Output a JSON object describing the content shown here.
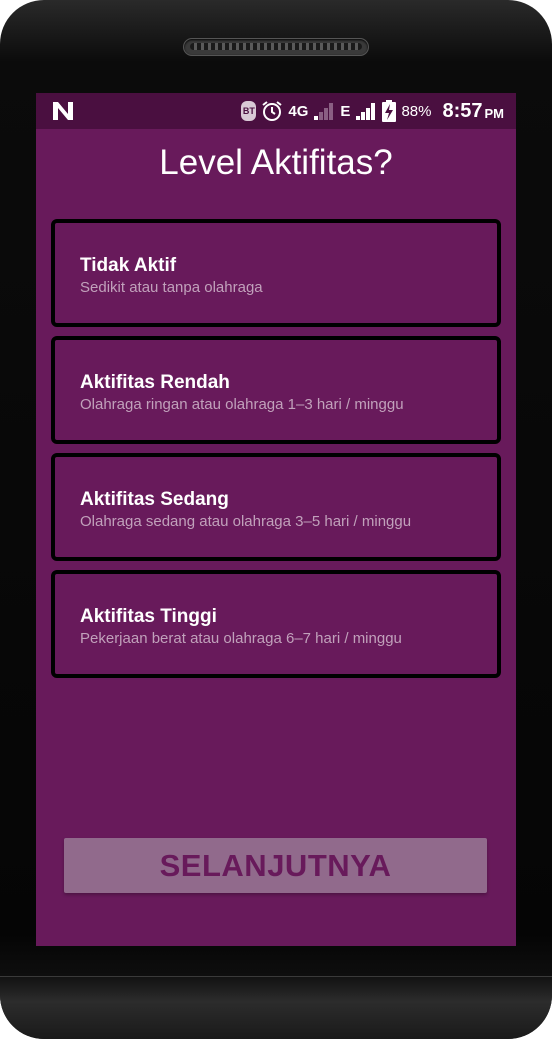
{
  "status_bar": {
    "notification_icon": "n-logo-icon",
    "bt_label": "BT",
    "network_4g": "4G",
    "network_e": "E",
    "battery_percent": "88%",
    "time": "8:57",
    "ampm": "PM"
  },
  "page": {
    "title": "Level Aktifitas?"
  },
  "options": [
    {
      "title": "Tidak Aktif",
      "subtitle": "Sedikit atau tanpa olahraga"
    },
    {
      "title": "Aktifitas Rendah",
      "subtitle": "Olahraga ringan atau olahraga 1–3 hari / minggu"
    },
    {
      "title": "Aktifitas Sedang",
      "subtitle": "Olahraga sedang atau olahraga 3–5 hari / minggu"
    },
    {
      "title": "Aktifitas Tinggi",
      "subtitle": "Pekerjaan berat atau olahraga 6–7 hari / minggu"
    }
  ],
  "next_button": {
    "label": "SELANJUTNYA"
  },
  "colors": {
    "background": "#681a5b",
    "status_bar": "#4a0f40",
    "button": "#916a8c",
    "border": "#000000"
  }
}
